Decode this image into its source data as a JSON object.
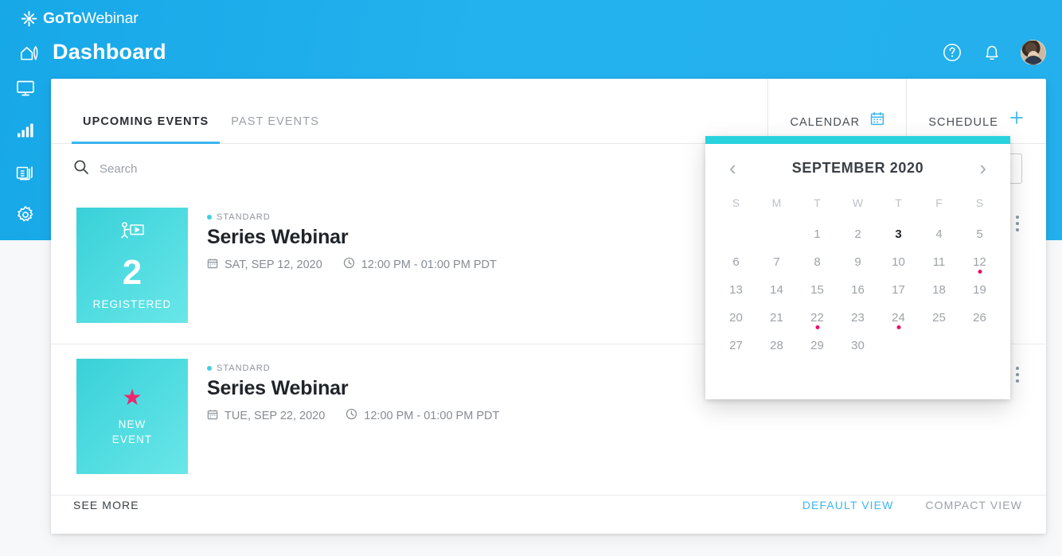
{
  "brand": {
    "logo_bold": "GoTo",
    "logo_light": "Webinar",
    "logo_icon": "asterisk-icon",
    "header_blue": "#23b0ec",
    "accent_teal": "#29d3de",
    "accent_blue": "#3ab6ef",
    "accent_pink": "#ec0f69"
  },
  "header": {
    "title": "Dashboard",
    "title_icon": "home-icon",
    "actions": [
      {
        "name": "help-icon",
        "glyph": "?"
      },
      {
        "name": "notifications-bell-icon",
        "glyph": "bell"
      },
      {
        "name": "user-avatar",
        "glyph": "avatar"
      }
    ]
  },
  "sidebar": {
    "items": [
      {
        "name": "sidebar-item-webinars",
        "icon": "monitor-icon"
      },
      {
        "name": "sidebar-item-analytics",
        "icon": "bar-chart-icon"
      },
      {
        "name": "sidebar-item-recordings",
        "icon": "video-library-icon"
      },
      {
        "name": "sidebar-item-settings",
        "icon": "gear-icon"
      }
    ]
  },
  "tabs": {
    "left": [
      {
        "label": "UPCOMING EVENTS",
        "active": true
      },
      {
        "label": "PAST EVENTS",
        "active": false
      }
    ],
    "right": [
      {
        "label": "CALENDAR",
        "icon": "calendar-icon"
      },
      {
        "label": "SCHEDULE",
        "icon": "plus-icon"
      }
    ]
  },
  "search": {
    "placeholder": "Search",
    "value": "",
    "icon": "search-icon"
  },
  "events": [
    {
      "thumb_kind": "registered",
      "thumb_icon": "presenter-screen-icon",
      "count": "2",
      "count_label": "REGISTERED",
      "badge": "STANDARD",
      "title": "Series Webinar",
      "date": "SAT, SEP 12, 2020",
      "time": "12:00 PM - 01:00 PM PDT"
    },
    {
      "thumb_kind": "new",
      "thumb_icon": "star-icon",
      "new_line1": "NEW",
      "new_line2": "EVENT",
      "badge": "STANDARD",
      "title": "Series Webinar",
      "date": "TUE, SEP 22, 2020",
      "time": "12:00 PM - 01:00 PM PDT"
    }
  ],
  "footer": {
    "see_more": "SEE MORE",
    "views": [
      {
        "label": "DEFAULT VIEW",
        "active": true
      },
      {
        "label": "COMPACT VIEW",
        "active": false
      }
    ]
  },
  "calendar": {
    "prev_icon": "chevron-left-icon",
    "next_icon": "chevron-right-icon",
    "month_label": "SEPTEMBER 2020",
    "dow": [
      "S",
      "M",
      "T",
      "W",
      "T",
      "F",
      "S"
    ],
    "lead_blanks": 2,
    "days": [
      1,
      2,
      3,
      4,
      5,
      6,
      7,
      8,
      9,
      10,
      11,
      12,
      13,
      14,
      15,
      16,
      17,
      18,
      19,
      20,
      21,
      22,
      23,
      24,
      25,
      26,
      27,
      28,
      29,
      30
    ],
    "today": 3,
    "event_days": [
      12,
      22,
      24
    ]
  }
}
